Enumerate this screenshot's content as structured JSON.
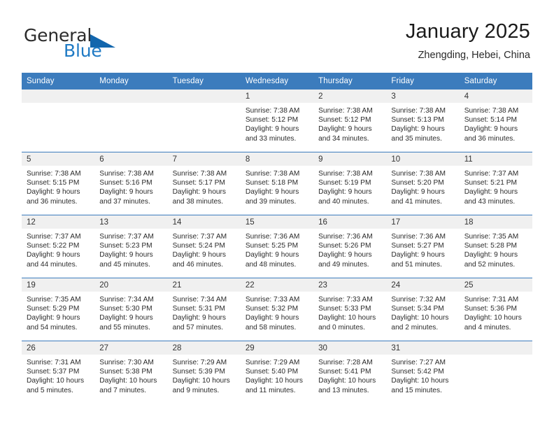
{
  "brand": {
    "word_one": "General",
    "word_two": "Blue",
    "triangle_icon": "brand-triangle-icon",
    "accent_color": "#1266ad",
    "blue_text_color": "#1f7ac4"
  },
  "header": {
    "title": "January 2025",
    "subtitle": "Zhengding, Hebei, China"
  },
  "theme": {
    "header_blue": "#3c7cbd",
    "daynum_band": "#f0f0f0",
    "text": "#2b2b2b"
  },
  "calendar": {
    "weekday_headers": [
      "Sunday",
      "Monday",
      "Tuesday",
      "Wednesday",
      "Thursday",
      "Friday",
      "Saturday"
    ],
    "weeks": [
      [
        {
          "day": "",
          "empty": true
        },
        {
          "day": "",
          "empty": true
        },
        {
          "day": "",
          "empty": true
        },
        {
          "day": "1",
          "sunrise": "Sunrise: 7:38 AM",
          "sunset": "Sunset: 5:12 PM",
          "daylight_1": "Daylight: 9 hours",
          "daylight_2": "and 33 minutes."
        },
        {
          "day": "2",
          "sunrise": "Sunrise: 7:38 AM",
          "sunset": "Sunset: 5:12 PM",
          "daylight_1": "Daylight: 9 hours",
          "daylight_2": "and 34 minutes."
        },
        {
          "day": "3",
          "sunrise": "Sunrise: 7:38 AM",
          "sunset": "Sunset: 5:13 PM",
          "daylight_1": "Daylight: 9 hours",
          "daylight_2": "and 35 minutes."
        },
        {
          "day": "4",
          "sunrise": "Sunrise: 7:38 AM",
          "sunset": "Sunset: 5:14 PM",
          "daylight_1": "Daylight: 9 hours",
          "daylight_2": "and 36 minutes."
        }
      ],
      [
        {
          "day": "5",
          "sunrise": "Sunrise: 7:38 AM",
          "sunset": "Sunset: 5:15 PM",
          "daylight_1": "Daylight: 9 hours",
          "daylight_2": "and 36 minutes."
        },
        {
          "day": "6",
          "sunrise": "Sunrise: 7:38 AM",
          "sunset": "Sunset: 5:16 PM",
          "daylight_1": "Daylight: 9 hours",
          "daylight_2": "and 37 minutes."
        },
        {
          "day": "7",
          "sunrise": "Sunrise: 7:38 AM",
          "sunset": "Sunset: 5:17 PM",
          "daylight_1": "Daylight: 9 hours",
          "daylight_2": "and 38 minutes."
        },
        {
          "day": "8",
          "sunrise": "Sunrise: 7:38 AM",
          "sunset": "Sunset: 5:18 PM",
          "daylight_1": "Daylight: 9 hours",
          "daylight_2": "and 39 minutes."
        },
        {
          "day": "9",
          "sunrise": "Sunrise: 7:38 AM",
          "sunset": "Sunset: 5:19 PM",
          "daylight_1": "Daylight: 9 hours",
          "daylight_2": "and 40 minutes."
        },
        {
          "day": "10",
          "sunrise": "Sunrise: 7:38 AM",
          "sunset": "Sunset: 5:20 PM",
          "daylight_1": "Daylight: 9 hours",
          "daylight_2": "and 41 minutes."
        },
        {
          "day": "11",
          "sunrise": "Sunrise: 7:37 AM",
          "sunset": "Sunset: 5:21 PM",
          "daylight_1": "Daylight: 9 hours",
          "daylight_2": "and 43 minutes."
        }
      ],
      [
        {
          "day": "12",
          "sunrise": "Sunrise: 7:37 AM",
          "sunset": "Sunset: 5:22 PM",
          "daylight_1": "Daylight: 9 hours",
          "daylight_2": "and 44 minutes."
        },
        {
          "day": "13",
          "sunrise": "Sunrise: 7:37 AM",
          "sunset": "Sunset: 5:23 PM",
          "daylight_1": "Daylight: 9 hours",
          "daylight_2": "and 45 minutes."
        },
        {
          "day": "14",
          "sunrise": "Sunrise: 7:37 AM",
          "sunset": "Sunset: 5:24 PM",
          "daylight_1": "Daylight: 9 hours",
          "daylight_2": "and 46 minutes."
        },
        {
          "day": "15",
          "sunrise": "Sunrise: 7:36 AM",
          "sunset": "Sunset: 5:25 PM",
          "daylight_1": "Daylight: 9 hours",
          "daylight_2": "and 48 minutes."
        },
        {
          "day": "16",
          "sunrise": "Sunrise: 7:36 AM",
          "sunset": "Sunset: 5:26 PM",
          "daylight_1": "Daylight: 9 hours",
          "daylight_2": "and 49 minutes."
        },
        {
          "day": "17",
          "sunrise": "Sunrise: 7:36 AM",
          "sunset": "Sunset: 5:27 PM",
          "daylight_1": "Daylight: 9 hours",
          "daylight_2": "and 51 minutes."
        },
        {
          "day": "18",
          "sunrise": "Sunrise: 7:35 AM",
          "sunset": "Sunset: 5:28 PM",
          "daylight_1": "Daylight: 9 hours",
          "daylight_2": "and 52 minutes."
        }
      ],
      [
        {
          "day": "19",
          "sunrise": "Sunrise: 7:35 AM",
          "sunset": "Sunset: 5:29 PM",
          "daylight_1": "Daylight: 9 hours",
          "daylight_2": "and 54 minutes."
        },
        {
          "day": "20",
          "sunrise": "Sunrise: 7:34 AM",
          "sunset": "Sunset: 5:30 PM",
          "daylight_1": "Daylight: 9 hours",
          "daylight_2": "and 55 minutes."
        },
        {
          "day": "21",
          "sunrise": "Sunrise: 7:34 AM",
          "sunset": "Sunset: 5:31 PM",
          "daylight_1": "Daylight: 9 hours",
          "daylight_2": "and 57 minutes."
        },
        {
          "day": "22",
          "sunrise": "Sunrise: 7:33 AM",
          "sunset": "Sunset: 5:32 PM",
          "daylight_1": "Daylight: 9 hours",
          "daylight_2": "and 58 minutes."
        },
        {
          "day": "23",
          "sunrise": "Sunrise: 7:33 AM",
          "sunset": "Sunset: 5:33 PM",
          "daylight_1": "Daylight: 10 hours",
          "daylight_2": "and 0 minutes."
        },
        {
          "day": "24",
          "sunrise": "Sunrise: 7:32 AM",
          "sunset": "Sunset: 5:34 PM",
          "daylight_1": "Daylight: 10 hours",
          "daylight_2": "and 2 minutes."
        },
        {
          "day": "25",
          "sunrise": "Sunrise: 7:31 AM",
          "sunset": "Sunset: 5:36 PM",
          "daylight_1": "Daylight: 10 hours",
          "daylight_2": "and 4 minutes."
        }
      ],
      [
        {
          "day": "26",
          "sunrise": "Sunrise: 7:31 AM",
          "sunset": "Sunset: 5:37 PM",
          "daylight_1": "Daylight: 10 hours",
          "daylight_2": "and 5 minutes."
        },
        {
          "day": "27",
          "sunrise": "Sunrise: 7:30 AM",
          "sunset": "Sunset: 5:38 PM",
          "daylight_1": "Daylight: 10 hours",
          "daylight_2": "and 7 minutes."
        },
        {
          "day": "28",
          "sunrise": "Sunrise: 7:29 AM",
          "sunset": "Sunset: 5:39 PM",
          "daylight_1": "Daylight: 10 hours",
          "daylight_2": "and 9 minutes."
        },
        {
          "day": "29",
          "sunrise": "Sunrise: 7:29 AM",
          "sunset": "Sunset: 5:40 PM",
          "daylight_1": "Daylight: 10 hours",
          "daylight_2": "and 11 minutes."
        },
        {
          "day": "30",
          "sunrise": "Sunrise: 7:28 AM",
          "sunset": "Sunset: 5:41 PM",
          "daylight_1": "Daylight: 10 hours",
          "daylight_2": "and 13 minutes."
        },
        {
          "day": "31",
          "sunrise": "Sunrise: 7:27 AM",
          "sunset": "Sunset: 5:42 PM",
          "daylight_1": "Daylight: 10 hours",
          "daylight_2": "and 15 minutes."
        },
        {
          "day": "",
          "empty": true
        }
      ]
    ]
  }
}
